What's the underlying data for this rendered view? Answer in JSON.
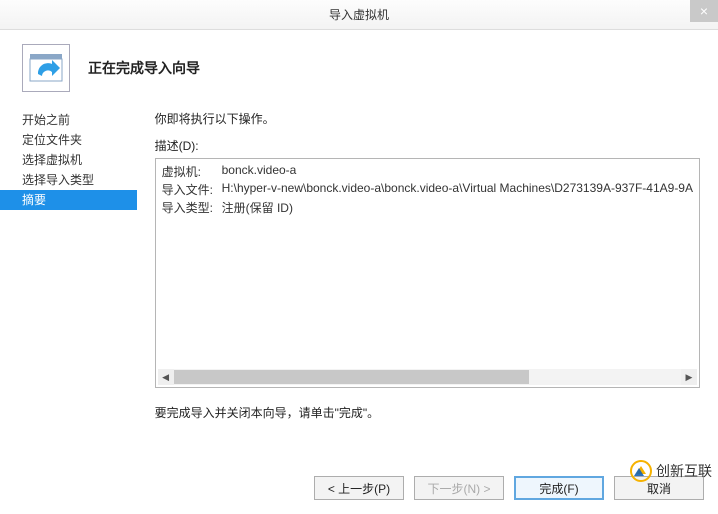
{
  "window": {
    "title": "导入虚拟机",
    "close_glyph": "×"
  },
  "header": {
    "page_title": "正在完成导入向导"
  },
  "sidebar": {
    "items": [
      {
        "label": "开始之前"
      },
      {
        "label": "定位文件夹"
      },
      {
        "label": "选择虚拟机"
      },
      {
        "label": "选择导入类型"
      },
      {
        "label": "摘要"
      }
    ]
  },
  "main": {
    "intro": "你即将执行以下操作。",
    "desc_label": "描述(D):",
    "kv": [
      {
        "key": "虚拟机:",
        "val": "bonck.video-a"
      },
      {
        "key": "导入文件:",
        "val": "H:\\hyper-v-new\\bonck.video-a\\bonck.video-a\\Virtual Machines\\D273139A-937F-41A9-9A"
      },
      {
        "key": "导入类型:",
        "val": "注册(保留 ID)"
      }
    ],
    "finish_hint": "要完成导入并关闭本向导，请单击\"完成\"。"
  },
  "buttons": {
    "prev": "< 上一步(P)",
    "next": "下一步(N) >",
    "finish": "完成(F)",
    "cancel": "取消"
  },
  "watermark": {
    "text": "创新互联"
  }
}
